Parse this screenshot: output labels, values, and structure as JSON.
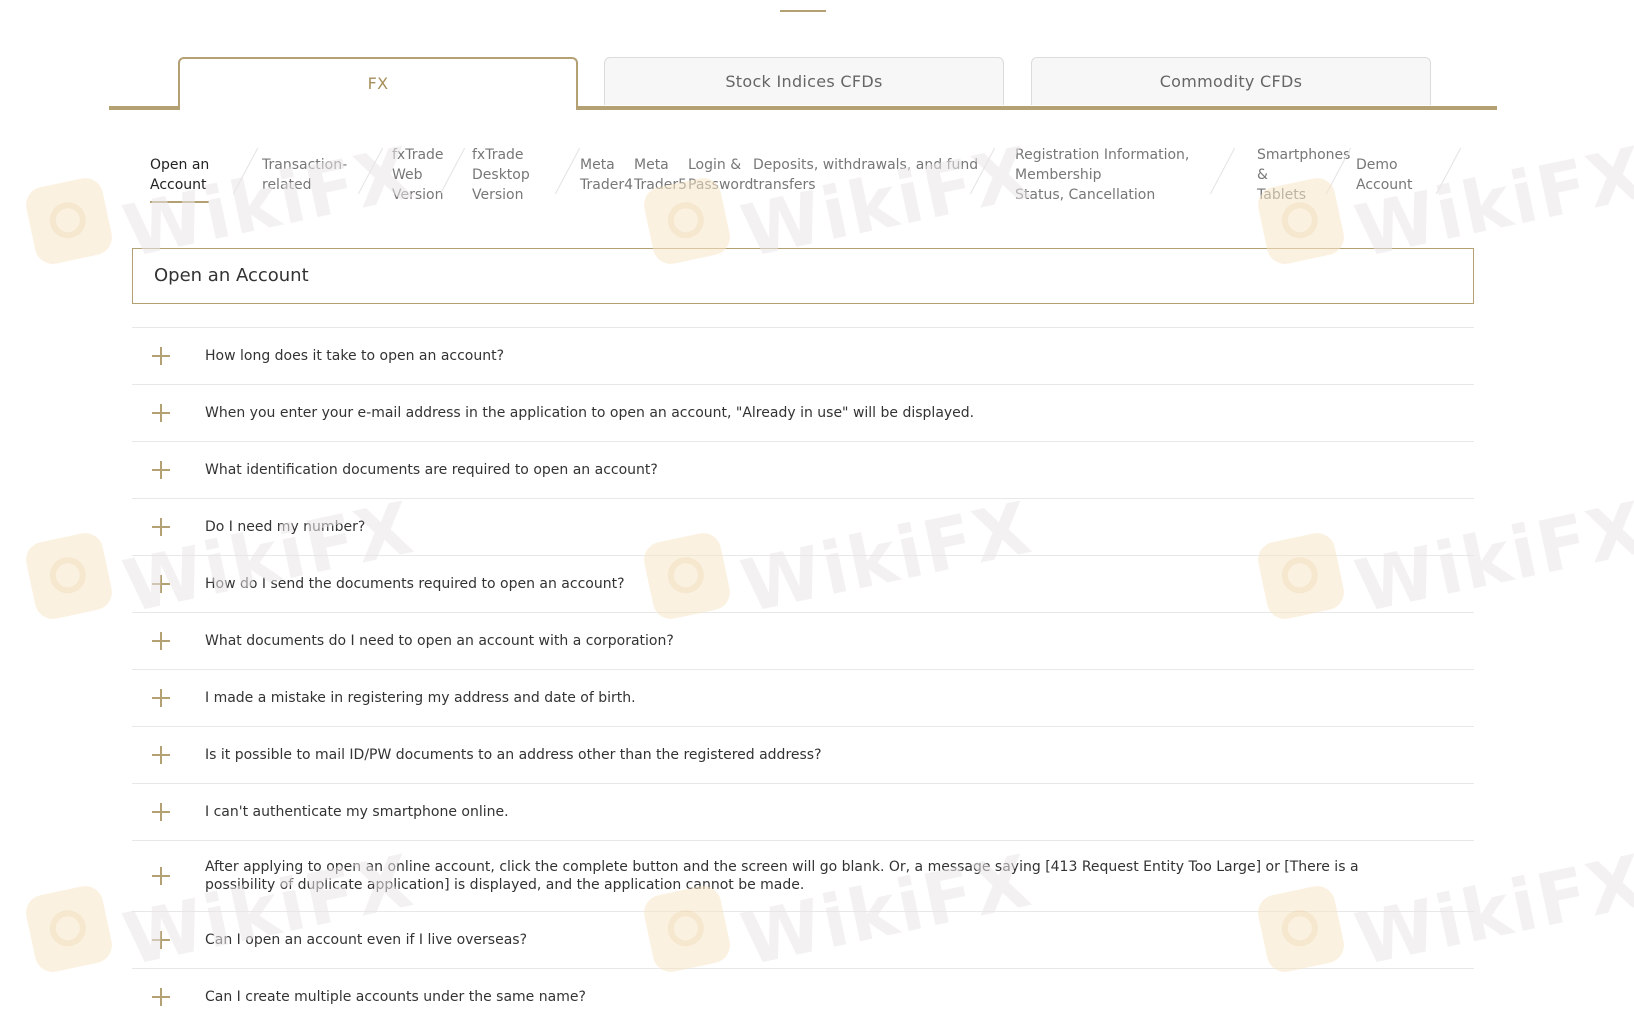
{
  "colors": {
    "accent": "#b3a073",
    "tab_inactive_bg": "#f7f7f7",
    "text": "#333333"
  },
  "main_tabs": [
    {
      "label": "FX",
      "active": true
    },
    {
      "label": "Stock Indices CFDs",
      "active": false
    },
    {
      "label": "Commodity CFDs",
      "active": false
    }
  ],
  "sub_tabs": [
    {
      "label": "Open an\nAccount",
      "active": true
    },
    {
      "label": "Transaction-\nrelated",
      "active": false
    },
    {
      "label": "fxTrade\nWeb\nVersion",
      "active": false
    },
    {
      "label": "fxTrade\nDesktop\nVersion",
      "active": false
    },
    {
      "label": "Meta\nTrader4",
      "active": false
    },
    {
      "label": "Meta\nTrader5",
      "active": false
    },
    {
      "label": "Login &\nPassword",
      "active": false
    },
    {
      "label": "Deposits, withdrawals, and fund\ntransfers",
      "active": false
    },
    {
      "label": "Registration Information,\nMembership\nStatus, Cancellation",
      "active": false
    },
    {
      "label": "Smartphones\n&\nTablets",
      "active": false
    },
    {
      "label": "Demo\nAccount",
      "active": false
    }
  ],
  "section_title": "Open an Account",
  "faq": [
    "How long does it take to open an account?",
    "When you enter your e-mail address in the application to open an account, \"Already in use\" will be displayed.",
    "What identification documents are required to open an account?",
    "Do I need my number?",
    "How do I send the documents required to open an account?",
    "What documents do I need to open an account with a corporation?",
    "I made a mistake in registering my address and date of birth.",
    "Is it possible to mail ID/PW documents to an address other than the registered address?",
    "I can't authenticate my smartphone online.",
    "After applying to open an online account, click the complete button and the screen will go blank. Or, a message saying [413 Request Entity Too Large] or [There is a possibility of duplicate application] is displayed, and the application cannot be made.",
    "Can I open an account even if I live overseas?",
    "Can I create multiple accounts under the same name?"
  ],
  "watermark": {
    "text": "WikiFX",
    "icon": "wikifx-logo-icon"
  }
}
